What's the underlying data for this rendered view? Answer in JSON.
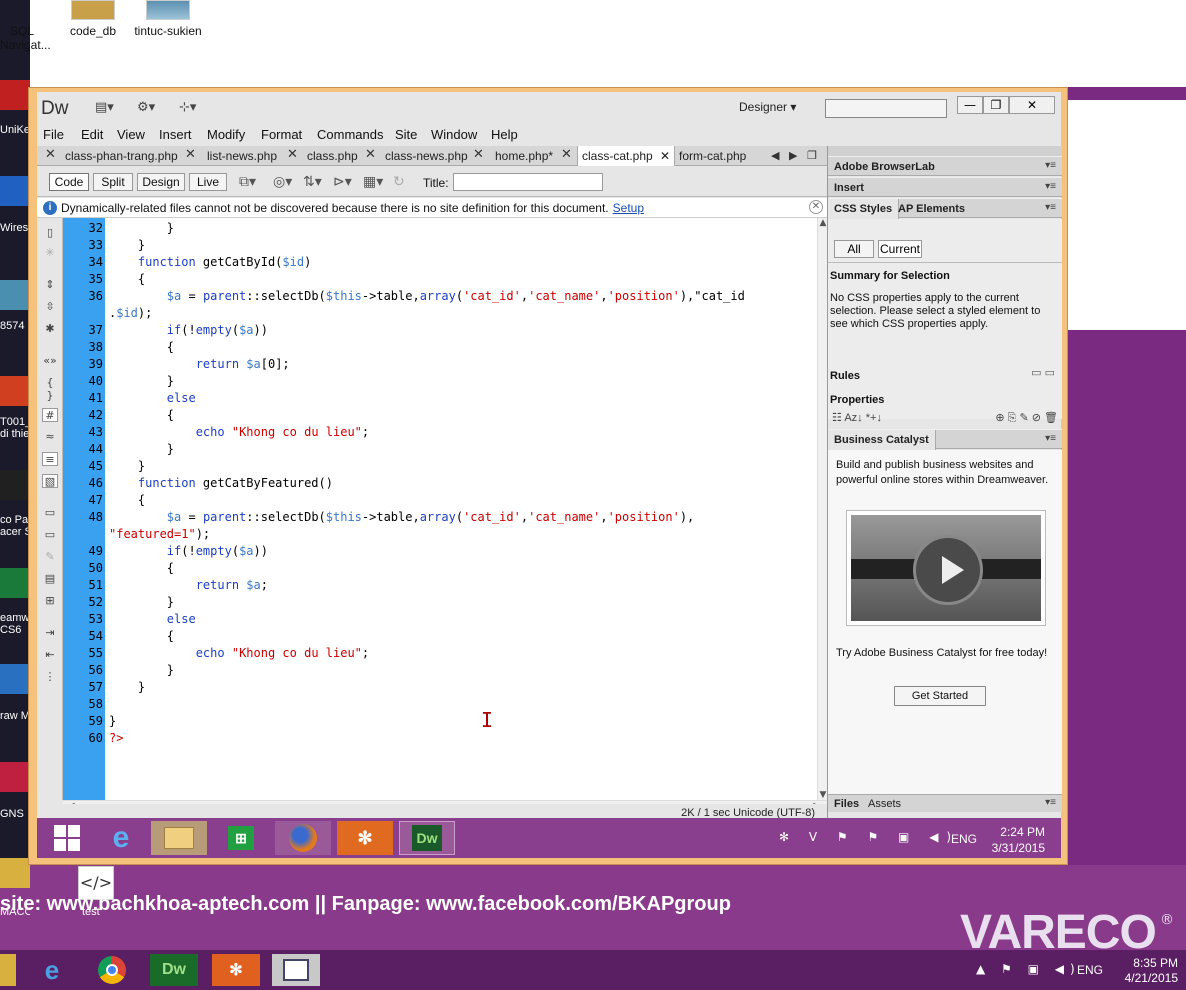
{
  "desktop": {
    "icons": [
      {
        "label": "SQL\nNavigat..."
      },
      {
        "label": "code_db"
      },
      {
        "label": "tintuc-sukien"
      }
    ],
    "side_labels": [
      "UniKe",
      "Wiresh",
      "8574",
      "T001_\ndi thie",
      "co Pa\nacer S",
      "eamw\nCS6",
      "raw M",
      "GNS",
      "MACOSX",
      "test"
    ],
    "promo": "site: www.bachkhoa-aptech.com  ||  Fanpage: www.facebook.com/BKAPgroup",
    "brand": "VARECO",
    "brand_reg": "®",
    "taskbar": {
      "time": "8:35 PM",
      "date": "4/21/2015",
      "lang": "ENG"
    }
  },
  "dreamweaver": {
    "logo": "Dw",
    "workspace": "Designer",
    "search_placeholder": "",
    "menu": [
      "File",
      "Edit",
      "View",
      "Insert",
      "Modify",
      "Format",
      "Commands",
      "Site",
      "Window",
      "Help"
    ],
    "tabs": [
      "class-phan-trang.php",
      "list-news.php",
      "class.php",
      "class-news.php",
      "home.php*",
      "class-cat.php",
      "form-cat.php"
    ],
    "active_tab": "class-cat.php",
    "view_buttons": [
      "Code",
      "Split",
      "Design",
      "Live"
    ],
    "title_label": "Title:",
    "title_value": "",
    "info_message": "Dynamically-related files cannot not be discovered because there is no site definition for this document.",
    "info_link": "Setup",
    "status": "2K / 1 sec  Unicode (UTF-8)",
    "code_lines": [
      {
        "num": "32",
        "html": "        }"
      },
      {
        "num": "33",
        "html": "    }"
      },
      {
        "num": "34",
        "html": "    function getCatById($id)"
      },
      {
        "num": "35",
        "html": "    {"
      },
      {
        "num": "36",
        "html": "        $a = parent::selectDb($this->table,array('cat_id','cat_name','position'),\"cat_id"
      },
      {
        "num": "",
        "html": ".$id);"
      },
      {
        "num": "37",
        "html": "        if(!empty($a))"
      },
      {
        "num": "38",
        "html": "        {"
      },
      {
        "num": "39",
        "html": "            return $a[0];"
      },
      {
        "num": "40",
        "html": "        }"
      },
      {
        "num": "41",
        "html": "        else"
      },
      {
        "num": "42",
        "html": "        {"
      },
      {
        "num": "43",
        "html": "            echo \"Khong co du lieu\";"
      },
      {
        "num": "44",
        "html": "        }"
      },
      {
        "num": "45",
        "html": "    }"
      },
      {
        "num": "46",
        "html": "    function getCatByFeatured()"
      },
      {
        "num": "47",
        "html": "    {"
      },
      {
        "num": "48",
        "html": "        $a = parent::selectDb($this->table,array('cat_id','cat_name','position'),"
      },
      {
        "num": "",
        "html": "\"featured=1\");"
      },
      {
        "num": "49",
        "html": "        if(!empty($a))"
      },
      {
        "num": "50",
        "html": "        {"
      },
      {
        "num": "51",
        "html": "            return $a;"
      },
      {
        "num": "52",
        "html": "        }"
      },
      {
        "num": "53",
        "html": "        else"
      },
      {
        "num": "54",
        "html": "        {"
      },
      {
        "num": "55",
        "html": "            echo \"Khong co du lieu\";"
      },
      {
        "num": "56",
        "html": "        }"
      },
      {
        "num": "57",
        "html": "    }"
      },
      {
        "num": "58",
        "html": ""
      },
      {
        "num": "59",
        "html": "}"
      },
      {
        "num": "60",
        "html": "?>"
      }
    ],
    "panels": {
      "browserlab": "Adobe BrowserLab",
      "insert": "Insert",
      "css_tab": "CSS Styles",
      "ap_tab": "AP Elements",
      "all_btn": "All",
      "current_btn": "Current",
      "summary_title": "Summary for Selection",
      "summary_body": "No CSS properties apply to the current selection.  Please select a styled element to see which CSS properties apply.",
      "rules": "Rules",
      "properties": "Properties",
      "bc_title": "Business Catalyst",
      "bc_text": "Build and publish business websites and powerful online stores within Dreamweaver.",
      "bc_try": "Try Adobe Business Catalyst for free today!",
      "get_started": "Get Started",
      "files_tab": "Files",
      "assets_tab": "Assets"
    },
    "inner_taskbar": {
      "lang": "ENG",
      "time": "2:24 PM",
      "date": "3/31/2015"
    }
  }
}
